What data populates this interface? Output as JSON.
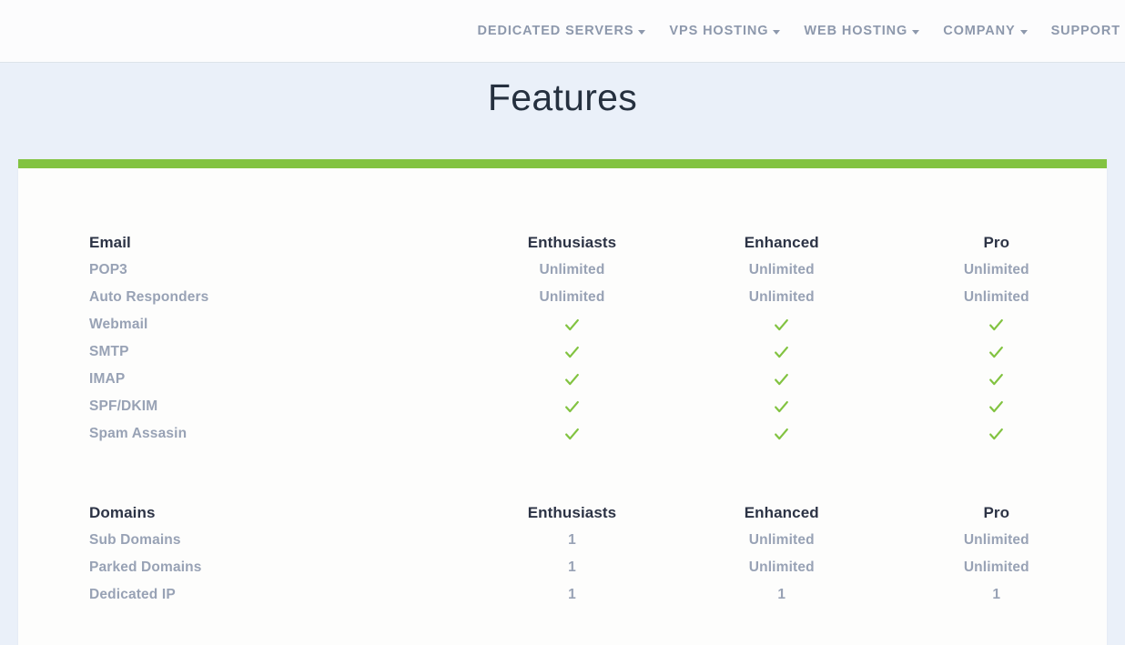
{
  "nav": {
    "items": [
      {
        "label": "DEDICATED SERVERS",
        "has_caret": true,
        "icon": "chevron-down-icon"
      },
      {
        "label": "VPS HOSTING",
        "has_caret": true,
        "icon": "chevron-down-icon"
      },
      {
        "label": "WEB HOSTING",
        "has_caret": true,
        "icon": "chevron-down-icon"
      },
      {
        "label": "COMPANY",
        "has_caret": true,
        "icon": "chevron-down-icon"
      },
      {
        "label": "SUPPORT",
        "has_caret": true,
        "icon": "chevron-down-icon"
      }
    ]
  },
  "page": {
    "title": "Features"
  },
  "colors": {
    "accent_green": "#82c341",
    "page_background": "#eaf0f9",
    "card_background": "#fdfdfc",
    "nav_text": "#8d98ac",
    "heading_text": "#25303f",
    "row_label_text": "#98a2b5",
    "section_head_text": "#2c3345"
  },
  "table": {
    "plans": [
      "Enthusiasts",
      "Enhanced",
      "Pro"
    ],
    "sections": [
      {
        "name": "Email",
        "rows": [
          {
            "label": "POP3",
            "values": [
              "Unlimited",
              "Unlimited",
              "Unlimited"
            ]
          },
          {
            "label": "Auto Responders",
            "values": [
              "Unlimited",
              "Unlimited",
              "Unlimited"
            ]
          },
          {
            "label": "Webmail",
            "values": [
              "check",
              "check",
              "check"
            ]
          },
          {
            "label": "SMTP",
            "values": [
              "check",
              "check",
              "check"
            ]
          },
          {
            "label": "IMAP",
            "values": [
              "check",
              "check",
              "check"
            ]
          },
          {
            "label": "SPF/DKIM",
            "values": [
              "check",
              "check",
              "check"
            ]
          },
          {
            "label": "Spam Assasin",
            "values": [
              "check",
              "check",
              "check"
            ]
          }
        ]
      },
      {
        "name": "Domains",
        "rows": [
          {
            "label": "Sub Domains",
            "values": [
              "1",
              "Unlimited",
              "Unlimited"
            ]
          },
          {
            "label": "Parked Domains",
            "values": [
              "1",
              "Unlimited",
              "Unlimited"
            ]
          },
          {
            "label": "Dedicated IP",
            "values": [
              "1",
              "1",
              "1"
            ]
          }
        ]
      }
    ]
  }
}
